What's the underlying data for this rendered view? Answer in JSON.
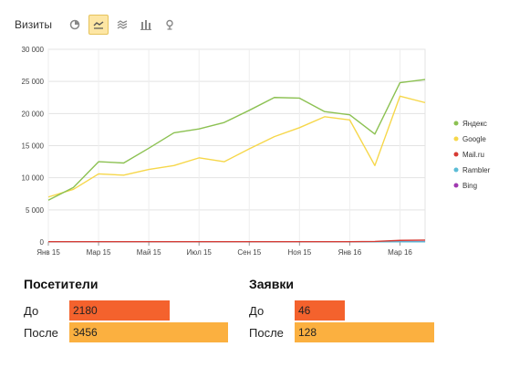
{
  "toolbar": {
    "title": "Визиты",
    "buttons": [
      {
        "icon": "pie-chart-icon",
        "active": false
      },
      {
        "icon": "line-chart-icon",
        "active": true
      },
      {
        "icon": "area-chart-icon",
        "active": false
      },
      {
        "icon": "bar-chart-icon",
        "active": false
      },
      {
        "icon": "map-pin-icon",
        "active": false
      }
    ]
  },
  "chart_data": {
    "type": "line",
    "x": [
      "Янв 15",
      "Фев 15",
      "Мар 15",
      "Апр 15",
      "Май 15",
      "Июн 15",
      "Июл 15",
      "Авг 15",
      "Сен 15",
      "Окт 15",
      "Ноя 15",
      "Дек 15",
      "Янв 16",
      "Фев 16",
      "Мар 16",
      "Апр 16"
    ],
    "x_tick_labels": [
      "Янв 15",
      "Мар 15",
      "Май 15",
      "Июл 15",
      "Сен 15",
      "Ноя 15",
      "Янв 16",
      "Мар 16"
    ],
    "ylim": [
      0,
      30000
    ],
    "y_ticks": [
      0,
      5000,
      10000,
      15000,
      20000,
      25000,
      30000
    ],
    "y_tick_labels": [
      "0",
      "5 000",
      "10 000",
      "15 000",
      "20 000",
      "25 000",
      "30 000"
    ],
    "grid": true,
    "legend_position": "right",
    "series": [
      {
        "name": "Яндекс",
        "color": "#8cc152",
        "values": [
          6500,
          8500,
          12500,
          12300,
          14600,
          17000,
          17600,
          18600,
          20500,
          22500,
          22400,
          20300,
          19800,
          16800,
          24800,
          25300
        ]
      },
      {
        "name": "Google",
        "color": "#f6d74a",
        "values": [
          7000,
          8200,
          10600,
          10400,
          11300,
          11900,
          13100,
          12500,
          14500,
          16400,
          17800,
          19500,
          19000,
          11900,
          22700,
          21700
        ]
      },
      {
        "name": "Mail.ru",
        "color": "#d63b34",
        "values": [
          50,
          40,
          40,
          40,
          40,
          40,
          40,
          40,
          40,
          40,
          40,
          40,
          50,
          80,
          250,
          300
        ]
      },
      {
        "name": "Rambler",
        "color": "#5bbcd6",
        "values": [
          20,
          20,
          20,
          20,
          20,
          20,
          20,
          20,
          20,
          20,
          20,
          20,
          20,
          20,
          30,
          30
        ]
      },
      {
        "name": "Bing",
        "color": "#a03ab0",
        "values": [
          30,
          30,
          30,
          30,
          30,
          30,
          30,
          30,
          30,
          30,
          30,
          30,
          30,
          40,
          60,
          60
        ]
      }
    ]
  },
  "visitors": {
    "title": "Посетители",
    "rows": [
      {
        "label": "До",
        "value": "2180",
        "fraction": 0.631,
        "color": "#f4622d"
      },
      {
        "label": "После",
        "value": "3456",
        "fraction": 1.0,
        "color": "#fbb040"
      }
    ]
  },
  "leads": {
    "title": "Заявки",
    "rows": [
      {
        "label": "До",
        "value": "46",
        "fraction": 0.359,
        "color": "#f4622d"
      },
      {
        "label": "После",
        "value": "128",
        "fraction": 1.0,
        "color": "#fbb040"
      }
    ]
  }
}
